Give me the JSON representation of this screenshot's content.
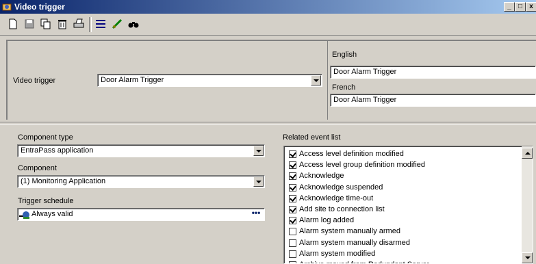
{
  "window": {
    "title": "Video trigger",
    "minimize": "_",
    "maximize": "□",
    "close": "x"
  },
  "toolbar": {
    "buttons": [
      {
        "icon": "new-icon"
      },
      {
        "icon": "save-icon"
      },
      {
        "icon": "copy-icon"
      },
      {
        "icon": "delete-icon"
      },
      {
        "icon": "print-icon"
      },
      {
        "icon": "list-icon"
      },
      {
        "icon": "link-icon"
      },
      {
        "icon": "find-icon"
      }
    ]
  },
  "header": {
    "video_trigger_label": "Video trigger",
    "video_trigger_value": "Door Alarm Trigger",
    "english_label": "English",
    "english_value": "Door Alarm Trigger",
    "french_label": "French",
    "french_value": "Door Alarm Trigger"
  },
  "form": {
    "component_type_label": "Component type",
    "component_type_value": "EntraPass application",
    "component_label": "Component",
    "component_value": "(1)  Monitoring Application",
    "trigger_schedule_label": "Trigger schedule",
    "trigger_schedule_value": "Always valid",
    "trigger_schedule_button": "•••"
  },
  "events": {
    "label": "Related event list",
    "items": [
      {
        "label": "Access level definition modified",
        "checked": true
      },
      {
        "label": "Access level group definition modified",
        "checked": true
      },
      {
        "label": "Acknowledge",
        "checked": true
      },
      {
        "label": "Acknowledge suspended",
        "checked": true
      },
      {
        "label": "Acknowledge time-out",
        "checked": true
      },
      {
        "label": "Add site to connection list",
        "checked": true
      },
      {
        "label": "Alarm log added",
        "checked": true
      },
      {
        "label": "Alarm system manually armed",
        "checked": false
      },
      {
        "label": "Alarm system manually disarmed",
        "checked": false
      },
      {
        "label": "Alarm system modified",
        "checked": false
      },
      {
        "label": "Archive moved from Redundant Server",
        "checked": false
      }
    ]
  }
}
